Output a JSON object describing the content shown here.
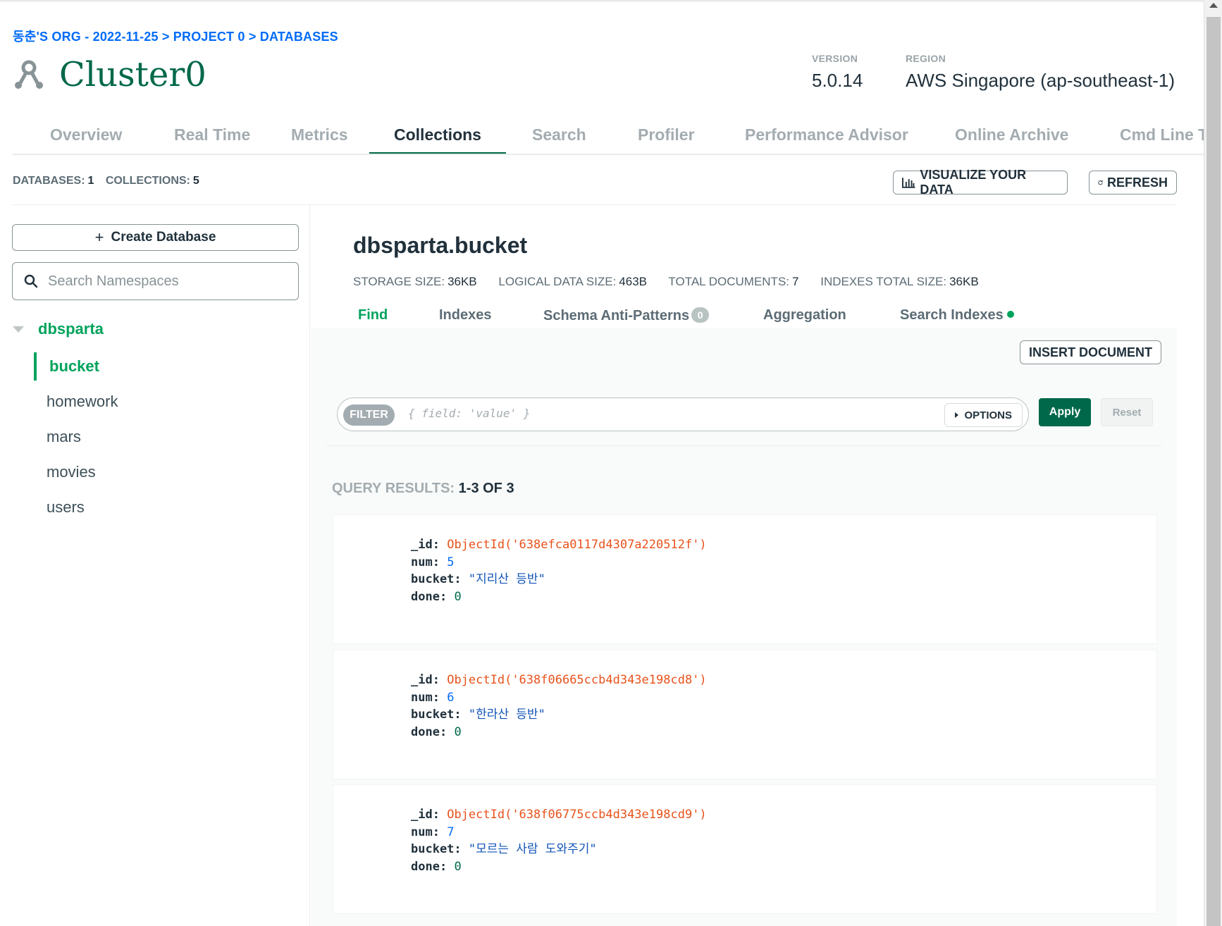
{
  "breadcrumb": "동춘'S ORG - 2022-11-25 > PROJECT 0 > DATABASES",
  "cluster": {
    "name": "Cluster0"
  },
  "meta": {
    "version_label": "VERSION",
    "version_value": "5.0.14",
    "region_label": "REGION",
    "region_value": "AWS Singapore (ap-southeast-1)"
  },
  "tabs": [
    "Overview",
    "Real Time",
    "Metrics",
    "Collections",
    "Search",
    "Profiler",
    "Performance Advisor",
    "Online Archive",
    "Cmd Line Tools"
  ],
  "active_tab": "Collections",
  "counts": {
    "databases_label": "DATABASES:",
    "databases_value": "1",
    "collections_label": "COLLECTIONS:",
    "collections_value": "5"
  },
  "toolbar": {
    "visualize_label": "VISUALIZE YOUR DATA",
    "refresh_label": "REFRESH"
  },
  "sidebar": {
    "create_db_label": "Create Database",
    "search_placeholder": "Search Namespaces",
    "database": "dbsparta",
    "collections": [
      "bucket",
      "homework",
      "mars",
      "movies",
      "users"
    ],
    "active_collection": "bucket"
  },
  "namespace": {
    "title": "dbsparta.bucket",
    "storage_label": "STORAGE SIZE:",
    "storage_value": "36KB",
    "logical_label": "LOGICAL DATA SIZE:",
    "logical_value": "463B",
    "total_docs_label": "TOTAL DOCUMENTS:",
    "total_docs_value": "7",
    "indexes_size_label": "INDEXES TOTAL SIZE:",
    "indexes_size_value": "36KB"
  },
  "subtabs": {
    "find": "Find",
    "indexes": "Indexes",
    "schema": "Schema Anti-Patterns",
    "schema_badge": "0",
    "aggregation": "Aggregation",
    "search_indexes": "Search Indexes"
  },
  "find": {
    "insert_label": "INSERT DOCUMENT",
    "filter_label": "FILTER",
    "filter_placeholder": "{ field: 'value' }",
    "options_label": "OPTIONS",
    "apply_label": "Apply",
    "reset_label": "Reset",
    "results_label": "QUERY RESULTS:",
    "results_value": "1-3 OF 3"
  },
  "documents": [
    {
      "id": "ObjectId('638efca0117d4307a220512f')",
      "num": "5",
      "bucket": "\"지리산 등반\"",
      "done": "0"
    },
    {
      "id": "ObjectId('638f06665ccb4d343e198cd8')",
      "num": "6",
      "bucket": "\"한라산 등반\"",
      "done": "0"
    },
    {
      "id": "ObjectId('638f06775ccb4d343e198cd9')",
      "num": "7",
      "bucket": "\"모르는 사람 도와주기\"",
      "done": "0"
    }
  ],
  "doc_keys": {
    "id": "_id:",
    "num": "num:",
    "bucket": "bucket:",
    "done": "done:"
  },
  "colors": {
    "brand_green": "#00684a",
    "accent_green": "#00a35c",
    "link_blue": "#016bf8",
    "oid_orange": "#e8521c"
  },
  "icons": {
    "cluster": "cluster-icon",
    "search": "search-icon",
    "chart": "bar-chart-icon",
    "refresh": "refresh-icon",
    "plus": "plus-icon",
    "caret": "caret-down-icon"
  }
}
